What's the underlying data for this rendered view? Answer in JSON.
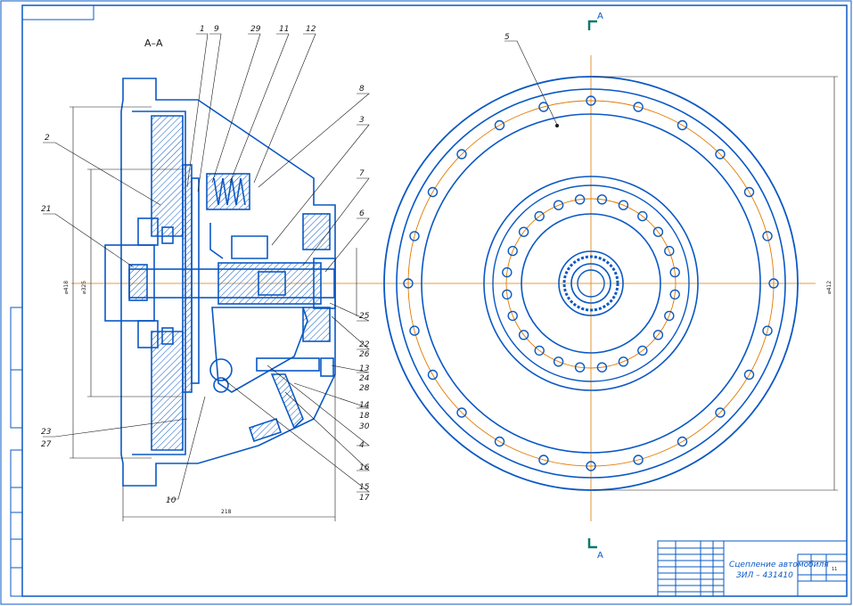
{
  "section_label": "А–А",
  "section_marks": {
    "top": "А",
    "bottom": "А"
  },
  "callouts": {
    "top": [
      "1",
      "9",
      "29",
      "11",
      "12"
    ],
    "right": [
      "8",
      "3",
      "7",
      "6",
      "25",
      "22",
      "26",
      "13",
      "24",
      "28",
      "14",
      "18",
      "30",
      "4",
      "16",
      "15",
      "17"
    ],
    "left": [
      "2",
      "21",
      "23",
      "27"
    ],
    "bottom": "10",
    "plan_view": "5"
  },
  "dimensions": {
    "dia_outer": "⌀418",
    "dia_inner": "⌀325",
    "width": "218",
    "plan_dia": "⌀412"
  },
  "title_block": {
    "title_line1": "Сцепление автомобиля",
    "title_line2": "ЗИЛ – 431410",
    "sheet_count": "11"
  },
  "colors": {
    "line": "#0a58c4",
    "axis": "#e07b00",
    "ink": "#1a1a1a",
    "marker": "#0a7a6a"
  }
}
